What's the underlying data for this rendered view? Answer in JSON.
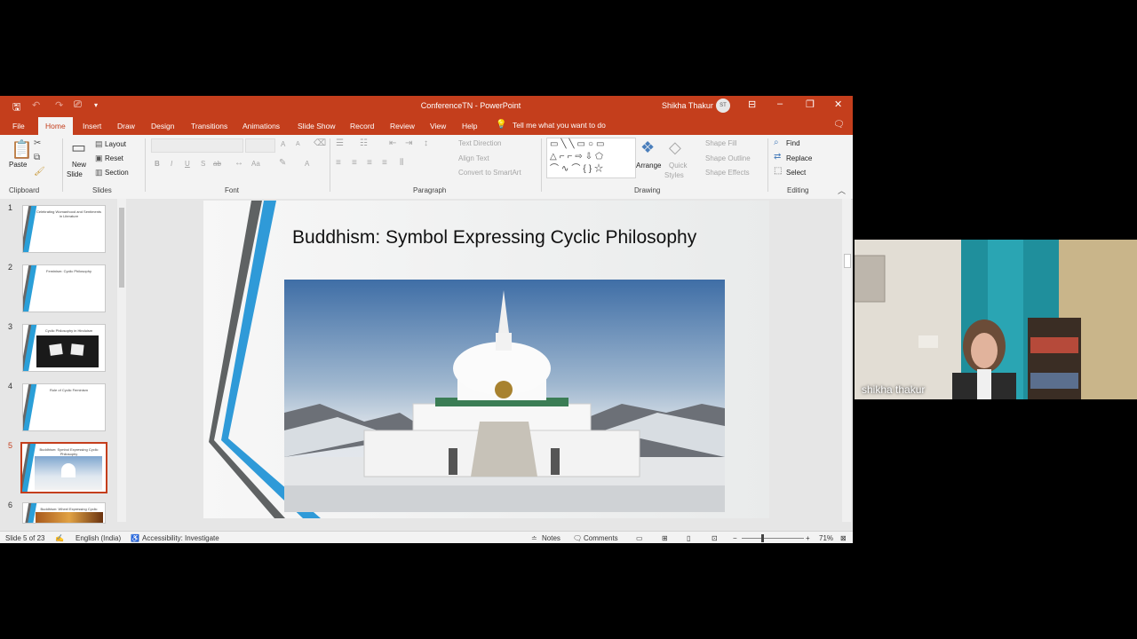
{
  "app": {
    "document_title": "ConferenceTN",
    "app_name": "PowerPoint",
    "title_sep": " - ",
    "user_name": "Shikha Thakur",
    "user_initials": "ST",
    "accent_color": "#c43e1c"
  },
  "tabs": [
    "File",
    "Home",
    "Insert",
    "Draw",
    "Design",
    "Transitions",
    "Animations",
    "Slide Show",
    "Record",
    "Review",
    "View",
    "Help"
  ],
  "active_tab": "Home",
  "tell_me": "Tell me what you want to do",
  "ribbon": {
    "clipboard": {
      "paste": "Paste",
      "label": "Clipboard"
    },
    "slides": {
      "new_slide_1": "New",
      "new_slide_2": "Slide",
      "layout": "Layout",
      "reset": "Reset",
      "section": "Section",
      "label": "Slides"
    },
    "font": {
      "label": "Font",
      "bold": "B",
      "italic": "I",
      "underline": "U",
      "strike": "S",
      "shadow": "ab",
      "size_up": "A",
      "size_down": "A",
      "case": "Aa",
      "color": "A"
    },
    "paragraph": {
      "label": "Paragraph",
      "text_direction": "Text Direction",
      "align_text": "Align Text",
      "convert_smartart": "Convert to SmartArt"
    },
    "drawing": {
      "label": "Drawing",
      "arrange": "Arrange",
      "quick_styles_1": "Quick",
      "quick_styles_2": "Styles",
      "shape_fill": "Shape Fill",
      "shape_outline": "Shape Outline",
      "shape_effects": "Shape Effects"
    },
    "editing": {
      "label": "Editing",
      "find": "Find",
      "replace": "Replace",
      "select": "Select"
    }
  },
  "thumbnails": [
    {
      "num": "1",
      "text": "Celebrating Womanhood and Sentiments in Literature"
    },
    {
      "num": "2",
      "text": "Feminism: Cyclic Philosophy"
    },
    {
      "num": "3",
      "text": "Cyclic Philosophy in Hinduism"
    },
    {
      "num": "4",
      "text": "Role of Cyclic Feminism"
    },
    {
      "num": "5",
      "text": "Buddhism: Symbol Expressing Cyclic Philosophy"
    },
    {
      "num": "6",
      "text": "Buddhism: Wheel Expressing Cyclic Philosophy"
    }
  ],
  "selected_slide": "5",
  "slide": {
    "title": "Buddhism: Symbol Expressing Cyclic Philosophy"
  },
  "status": {
    "slide_of": "Slide 5 of 23",
    "language": "English (India)",
    "accessibility": "Accessibility: Investigate",
    "notes": "Notes",
    "comments": "Comments",
    "zoom": "71%"
  },
  "video": {
    "participant_name": "shikha thakur"
  }
}
